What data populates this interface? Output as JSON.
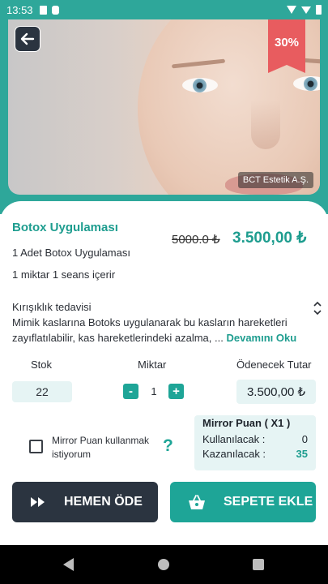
{
  "status_bar": {
    "time": "13:53"
  },
  "hero": {
    "discount": "30%",
    "brand": "BCT Estetik A.Ş."
  },
  "product": {
    "title": "Botox Uygulaması",
    "old_price": "5000.0 ₺",
    "new_price": "3.500,00 ₺",
    "line1": "1 Adet Botox Uygulaması",
    "line2": "1 miktar 1 seans içerir",
    "desc_title": "Kırışıklık tedavisi",
    "desc_body": "Mimik kaslarına Botoks uygulanarak bu kasların hareketleri zayıflatılabilir, kas hareketlerindeki azalma, ...",
    "read_more": "Devamını Oku"
  },
  "order": {
    "stock_label": "Stok",
    "qty_label": "Miktar",
    "total_label": "Ödenecek Tutar",
    "stock_value": "22",
    "qty_minus": "-",
    "qty_value": "1",
    "qty_plus": "+",
    "total_value": "3.500,00 ₺"
  },
  "mirror": {
    "checkbox_label": "Mirror Puan kullanmak istiyorum",
    "help": "?",
    "title": "Mirror Puan ( X1 )",
    "use_label": "Kullanılacak :",
    "use_value": "0",
    "earn_label": "Kazanılacak :",
    "earn_value": "35"
  },
  "actions": {
    "pay_label": "HEMEN ÖDE",
    "cart_label": "SEPETE EKLE"
  },
  "colors": {
    "accent": "#1e9d8f",
    "dark": "#2b3440",
    "discount": "#e85c5f",
    "soft_box": "#e6f4f4"
  }
}
